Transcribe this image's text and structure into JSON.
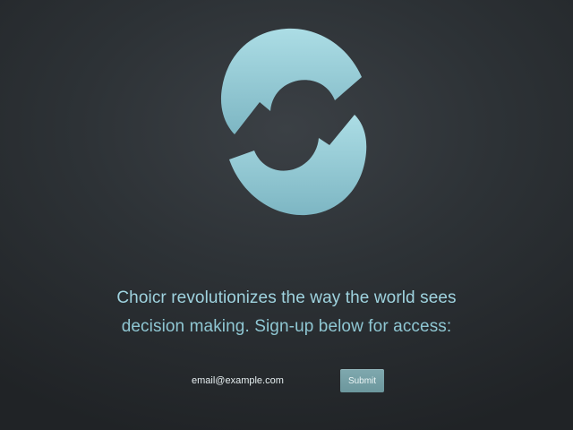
{
  "brand": {
    "logo_icon": "circular-arrows-icon",
    "logo_color_top": "#a9dbe3",
    "logo_color_bottom": "#7fbac6"
  },
  "tagline": {
    "line1": "Choicr revolutionizes the way the world sees",
    "line2": "decision making. Sign-up below for access:"
  },
  "signup": {
    "email_placeholder": "email@example.com",
    "submit_label": "Submit"
  },
  "colors": {
    "background": "#2d3236",
    "text_accent": "#9fd3df",
    "button": "#7fa8ae"
  }
}
